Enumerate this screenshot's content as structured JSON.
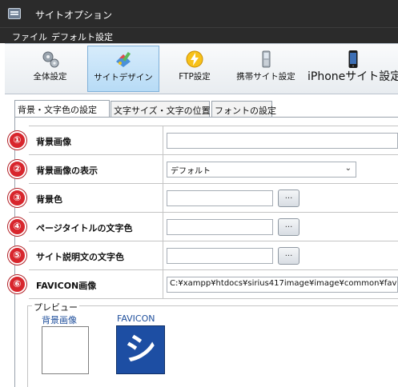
{
  "window": {
    "title": "サイトオプション"
  },
  "menu": {
    "items": [
      "ファイル",
      "デフォルト設定"
    ]
  },
  "toolbar": {
    "buttons": [
      {
        "label": "全体設定",
        "icon": "gears-icon",
        "active": false
      },
      {
        "label": "サイトデザイン",
        "icon": "palette-brush-icon",
        "active": true
      },
      {
        "label": "FTP設定",
        "icon": "lightning-icon",
        "active": false
      },
      {
        "label": "携帯サイト設定",
        "icon": "mobile-phone-icon",
        "active": false
      },
      {
        "label": "iPhoneサイト設定",
        "icon": "iphone-icon",
        "active": false
      }
    ]
  },
  "tabs": [
    {
      "label": "背景・文字色の設定",
      "active": true
    },
    {
      "label": "文字サイズ・文字の位置",
      "active": false
    },
    {
      "label": "フォントの設定",
      "active": false
    }
  ],
  "settings": {
    "rows": [
      {
        "num": "①",
        "label": "背景画像",
        "control": "text",
        "value": ""
      },
      {
        "num": "②",
        "label": "背景画像の表示",
        "control": "select",
        "value": "デフォルト"
      },
      {
        "num": "③",
        "label": "背景色",
        "control": "color",
        "value": "",
        "button": "..."
      },
      {
        "num": "④",
        "label": "ページタイトルの文字色",
        "control": "color",
        "value": "",
        "button": "..."
      },
      {
        "num": "⑤",
        "label": "サイト説明文の文字色",
        "control": "color",
        "value": "",
        "button": "..."
      },
      {
        "num": "⑥",
        "label": "FAVICON画像",
        "control": "text",
        "value": "C:¥xampp¥htdocs¥sirius417image¥image¥common¥fav"
      }
    ]
  },
  "preview": {
    "title": "プレビュー",
    "bg_label": "背景画像",
    "favicon_label": "FAVICON",
    "favicon_glyph": "シ"
  },
  "colors": {
    "titlebar": "#2b2b2b",
    "badge": "#d8262d",
    "active_button": "#b7dbf6",
    "favicon_bg": "#1d4ea3"
  }
}
